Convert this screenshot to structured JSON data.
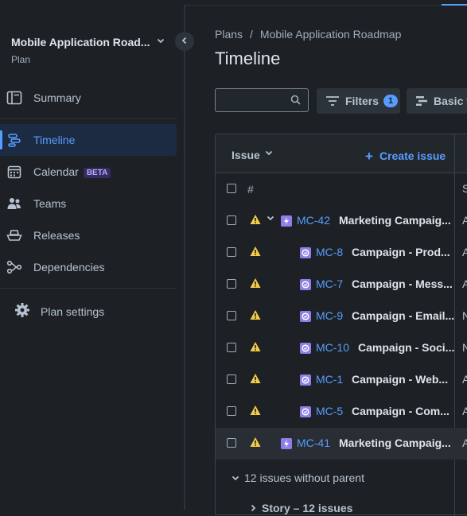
{
  "colors": {
    "accent": "#579dff",
    "background": "#1d2125",
    "warning": "#f5cd47",
    "epic": "#8f7ee7",
    "task": "#8f7ee7"
  },
  "project": {
    "title": "Mobile Application Road...",
    "subtitle": "Plan"
  },
  "sidebar": {
    "items": [
      {
        "label": "Summary",
        "icon": "summary-icon",
        "active": false
      },
      {
        "label": "Timeline",
        "icon": "timeline-icon",
        "active": true
      },
      {
        "label": "Calendar",
        "icon": "calendar-icon",
        "badge": "BETA",
        "active": false
      },
      {
        "label": "Teams",
        "icon": "teams-icon",
        "active": false
      },
      {
        "label": "Releases",
        "icon": "releases-icon",
        "active": false
      },
      {
        "label": "Dependencies",
        "icon": "dependencies-icon",
        "active": false
      }
    ],
    "settings_label": "Plan settings"
  },
  "breadcrumb": {
    "root": "Plans",
    "separator": "/",
    "current": "Mobile Application Roadmap"
  },
  "page": {
    "title": "Timeline"
  },
  "toolbar": {
    "search_placeholder": "",
    "filters_label": "Filters",
    "filters_count": "1",
    "view_label": "Basic v"
  },
  "table": {
    "issue_header": "Issue",
    "create_label": "Create issue",
    "number_header": "#",
    "status_header": "S",
    "rows": [
      {
        "key": "MC-42",
        "summary": "Marketing Campaig...",
        "type": "epic",
        "level": 0,
        "expanded": true,
        "status": "A",
        "selected": false
      },
      {
        "key": "MC-8",
        "summary": "Campaign - Prod...",
        "type": "task",
        "level": 1,
        "status": "A",
        "selected": false
      },
      {
        "key": "MC-7",
        "summary": "Campaign - Mess...",
        "type": "task",
        "level": 1,
        "status": "A",
        "selected": false
      },
      {
        "key": "MC-9",
        "summary": "Campaign - Email...",
        "type": "task",
        "level": 1,
        "status": "N",
        "selected": false
      },
      {
        "key": "MC-10",
        "summary": "Campaign - Soci...",
        "type": "task",
        "level": 1,
        "status": "N",
        "selected": false
      },
      {
        "key": "MC-1",
        "summary": "Campaign - Web...",
        "type": "task",
        "level": 1,
        "status": "A",
        "selected": false
      },
      {
        "key": "MC-5",
        "summary": "Campaign - Com...",
        "type": "task",
        "level": 1,
        "status": "A",
        "selected": false
      },
      {
        "key": "MC-41",
        "summary": "Marketing Campaig...",
        "type": "epic",
        "level": 0,
        "expanded": false,
        "status": "A",
        "selected": true
      }
    ],
    "group_label": "12 issues without parent",
    "subgroup_label": "Story – 12 issues"
  }
}
